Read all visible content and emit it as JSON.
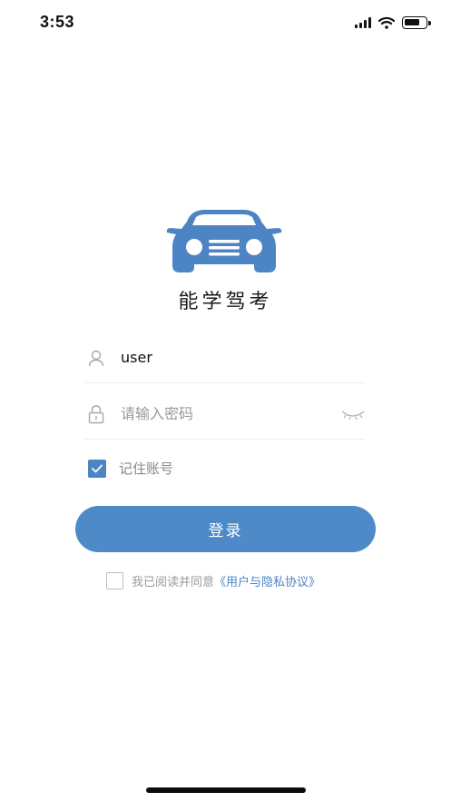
{
  "status_bar": {
    "time": "3:53",
    "icons": [
      "signal-icon",
      "wifi-icon",
      "battery-icon"
    ]
  },
  "app": {
    "logo_icon": "car-icon",
    "title": "能学驾考"
  },
  "login_form": {
    "username": {
      "icon": "user-icon",
      "value": "user"
    },
    "password": {
      "icon": "lock-icon",
      "placeholder": "请输入密码",
      "toggle_icon": "eye-closed-icon"
    },
    "remember": {
      "checked": true,
      "label": "记住账号"
    },
    "submit_label": "登录",
    "agreement": {
      "checked": false,
      "text": "我已阅读并同意",
      "link_text": "《用户与隐私协议》"
    }
  },
  "colors": {
    "accent": "#4f8ac8",
    "logo": "#4d84c4",
    "placeholder": "#9a9a9a"
  }
}
